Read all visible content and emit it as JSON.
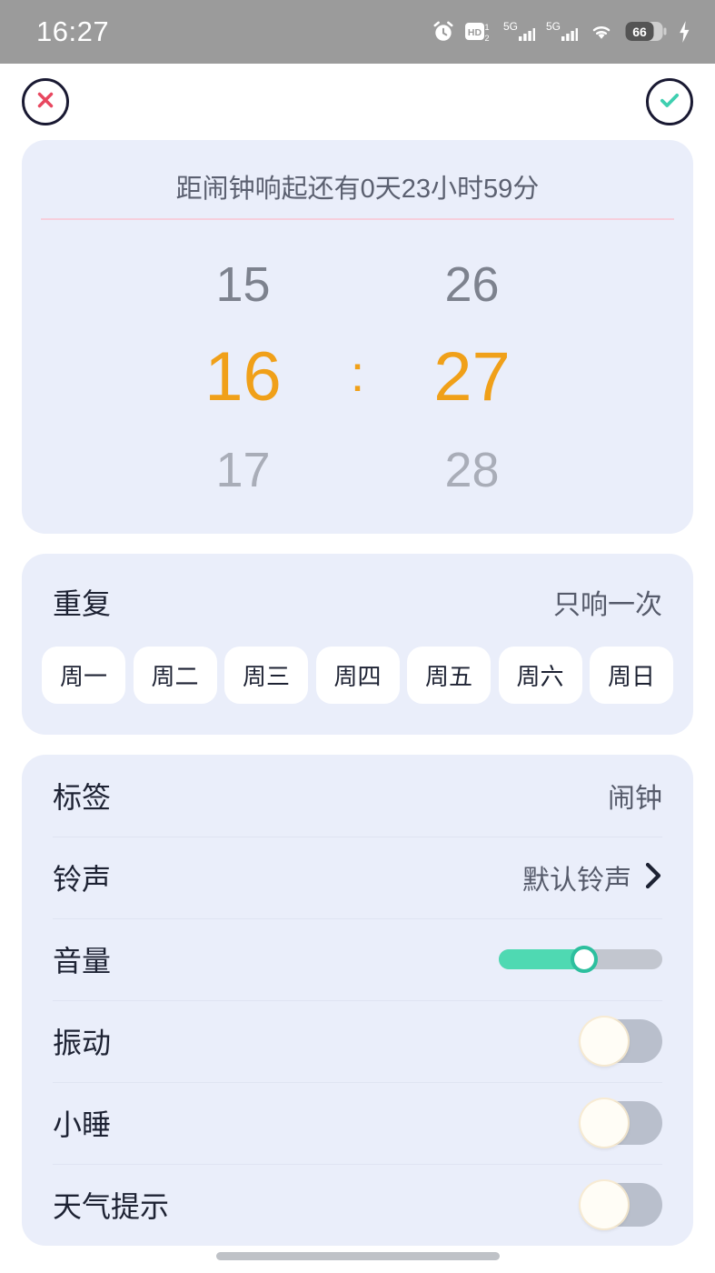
{
  "statusbar": {
    "time": "16:27",
    "icons": [
      "alarm-icon",
      "volte-hd-icon",
      "signal-5g-sim1-icon",
      "signal-5g-sim2-icon",
      "wifi-icon",
      "battery-icon",
      "charging-bolt-icon"
    ],
    "volte_label": "HD",
    "volte_sim_top": "1",
    "volte_sim_bottom": "2",
    "network_1": "5G",
    "network_2": "5G",
    "battery_level": "66"
  },
  "header": {
    "cancel_icon": "close-x-icon",
    "confirm_icon": "check-icon",
    "cancel_color": "#e8475f",
    "confirm_color": "#3ecfb0",
    "outline_color": "#191932"
  },
  "time_card": {
    "countdown": "距闹钟响起还有0天23小时59分",
    "rule_color": "#f6cfdc",
    "picker": {
      "hour_prev": "15",
      "hour_selected": "16",
      "hour_next": "17",
      "separator": ":",
      "minute_prev": "26",
      "minute_selected": "27",
      "minute_next": "28",
      "selected_color": "#f0a019"
    }
  },
  "repeat_card": {
    "label": "重复",
    "value": "只响一次",
    "days": [
      {
        "label": "周一",
        "selected": false
      },
      {
        "label": "周二",
        "selected": false
      },
      {
        "label": "周三",
        "selected": false
      },
      {
        "label": "周四",
        "selected": false
      },
      {
        "label": "周五",
        "selected": false
      },
      {
        "label": "周六",
        "selected": false
      },
      {
        "label": "周日",
        "selected": false
      }
    ]
  },
  "settings_card": {
    "rows": [
      {
        "label": "标签",
        "value": "闹钟",
        "control": "text"
      },
      {
        "label": "铃声",
        "value": "默认铃声",
        "control": "chevron"
      },
      {
        "label": "音量",
        "control": "slider",
        "slider_percent": 52,
        "fill_color": "#4fd9b2",
        "track_color": "#c2c6cf"
      },
      {
        "label": "振动",
        "control": "toggle",
        "on": false
      },
      {
        "label": "小睡",
        "control": "toggle",
        "on": false
      },
      {
        "label": "天气提示",
        "control": "toggle",
        "on": false
      }
    ],
    "label_tag": "标签",
    "value_tag": "闹钟",
    "label_ringtone": "铃声",
    "value_ringtone": "默认铃声",
    "label_volume": "音量",
    "label_vibrate": "振动",
    "label_snooze": "小睡",
    "label_weather": "天气提示"
  }
}
